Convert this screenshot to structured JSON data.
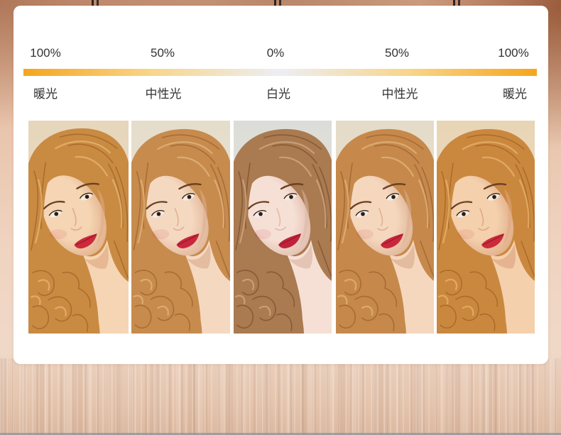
{
  "columns": [
    {
      "percent": "100%",
      "label": "暖光",
      "photo": {
        "bg": "#e6d6bb",
        "bg_low": "#eddcc2",
        "hair": "#c98a42",
        "hair_dark": "#94561f",
        "hair_light": "#e8b874",
        "skin": "#f5d5b3",
        "skin_shadow": "#dfab86",
        "lips": "#cb2a3b"
      }
    },
    {
      "percent": "50%",
      "label": "中性光",
      "photo": {
        "bg": "#e5ddcc",
        "bg_low": "#ece2d2",
        "hair": "#c78b4d",
        "hair_dark": "#8f5426",
        "hair_light": "#e4b780",
        "skin": "#f5d8c0",
        "skin_shadow": "#ddb093",
        "lips": "#c9263d"
      }
    },
    {
      "percent": "0%",
      "label": "白光",
      "photo": {
        "bg": "#dcddd8",
        "bg_low": "#e8e4de",
        "hair": "#aa7a50",
        "hair_dark": "#6c4327",
        "hair_light": "#d2ab86",
        "skin": "#f6e0d5",
        "skin_shadow": "#ddb8a7",
        "lips": "#c0223a"
      }
    },
    {
      "percent": "50%",
      "label": "中性光",
      "photo": {
        "bg": "#e4dbc8",
        "bg_low": "#ebe1cf",
        "hair": "#c6894b",
        "hair_dark": "#8e5325",
        "hair_light": "#e3b67e",
        "skin": "#f5d7be",
        "skin_shadow": "#dcaf91",
        "lips": "#c9263d"
      }
    },
    {
      "percent": "100%",
      "label": "暖光",
      "photo": {
        "bg": "#e8d5b6",
        "bg_low": "#efdcc0",
        "hair": "#ca883f",
        "hair_dark": "#96551c",
        "hair_light": "#e9b56c",
        "skin": "#f4d0ac",
        "skin_shadow": "#dea783",
        "lips": "#cb2a3b"
      }
    }
  ],
  "gradient_bar": {
    "warm": "#f6a51d",
    "mid": "#f8d58a",
    "white": "#eceef4"
  },
  "features": {
    "brow": "#6a4024",
    "eye": "#2e1c13",
    "eye_white": "#f3ebe5",
    "lip_line": "#8a1325"
  },
  "colors": {
    "text": "#333333"
  }
}
